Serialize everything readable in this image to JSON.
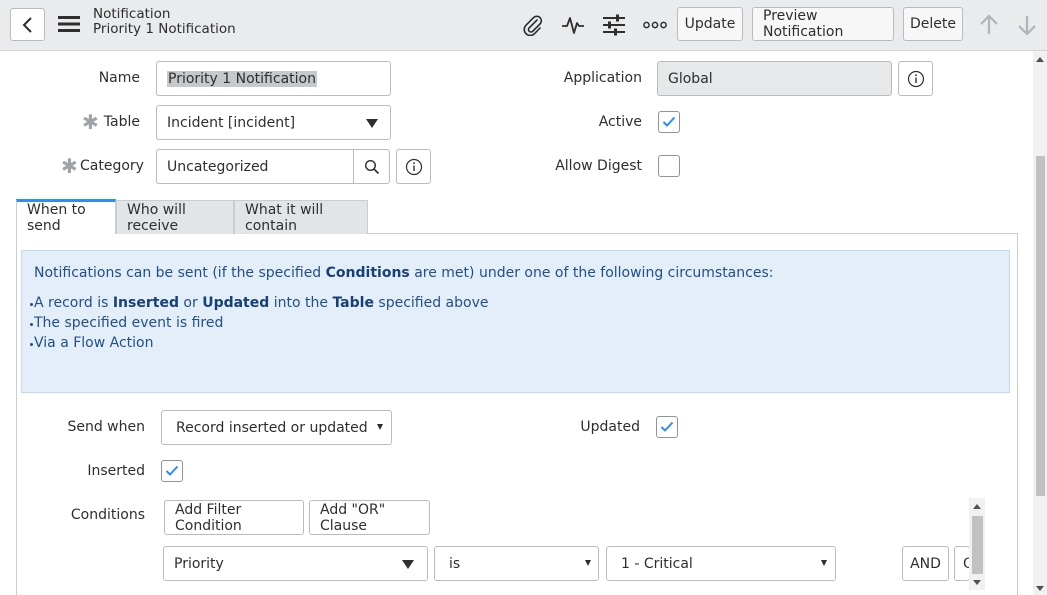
{
  "header": {
    "title": "Notification",
    "subtitle": "Priority 1 Notification",
    "buttons": {
      "update": "Update",
      "preview": "Preview Notification",
      "delete": "Delete"
    },
    "icons": [
      "back-icon",
      "menu-icon",
      "paperclip-icon",
      "activity-icon",
      "settings-sliders-icon",
      "more-icon",
      "arrow-up-icon",
      "arrow-down-icon"
    ]
  },
  "form": {
    "name": {
      "label": "Name",
      "value": "Priority 1 Notification"
    },
    "table": {
      "label": "Table",
      "value": "Incident [incident]"
    },
    "category": {
      "label": "Category",
      "value": "Uncategorized"
    },
    "application": {
      "label": "Application",
      "value": "Global"
    },
    "active": {
      "label": "Active",
      "checked": true
    },
    "allow_digest": {
      "label": "Allow Digest",
      "checked": false
    }
  },
  "tabs": [
    {
      "label": "When to send",
      "active": true
    },
    {
      "label": "Who will receive",
      "active": false
    },
    {
      "label": "What it will contain",
      "active": false
    }
  ],
  "info": {
    "intro_1": "Notifications can be sent (if the specified ",
    "intro_bold": "Conditions",
    "intro_2": " are met) under one of the following circumstances:",
    "item1": {
      "a": "A record is ",
      "b": "Inserted",
      "c": " or ",
      "d": "Updated",
      "e": " into the ",
      "f": "Table",
      "g": " specified above"
    },
    "item2": "The specified event is fired",
    "item3": "Via a Flow Action"
  },
  "send": {
    "send_when": {
      "label": "Send when",
      "value": "Record inserted or updated"
    },
    "updated": {
      "label": "Updated",
      "checked": true
    },
    "inserted": {
      "label": "Inserted",
      "checked": true
    },
    "conditions": {
      "label": "Conditions",
      "add_filter": "Add Filter Condition",
      "add_or": "Add \"OR\" Clause",
      "field": "Priority",
      "operator": "is",
      "value": "1 - Critical",
      "and": "AND",
      "or": "O"
    }
  },
  "colors": {
    "accent": "#278efc",
    "info_bg": "#e4eef8",
    "info_text": "#1f4f8c",
    "header_bg": "#e9ebed"
  }
}
